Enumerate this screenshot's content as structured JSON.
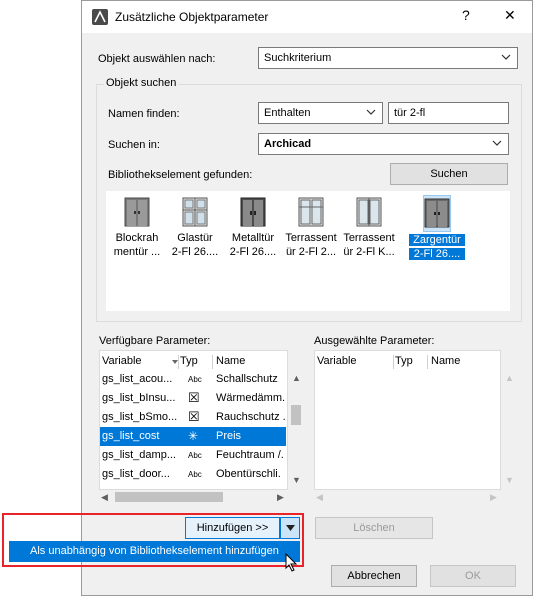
{
  "window": {
    "title": "Zusätzliche Objektparameter",
    "help_label": "?",
    "close_label": "✕"
  },
  "select_by": {
    "label": "Objekt auswählen nach:",
    "value": "Suchkriterium"
  },
  "search_group": {
    "title": "Objekt suchen",
    "find_names_label": "Namen finden:",
    "match_mode": "Enthalten",
    "search_text": "tür 2-fl",
    "search_in_label": "Suchen in:",
    "search_in_value": "Archicad",
    "found_label": "Bibliothekselement gefunden:",
    "search_button": "Suchen"
  },
  "library_items": [
    {
      "line1": "Blockrah",
      "line2": "mentür ..."
    },
    {
      "line1": "Glastür",
      "line2": "2-Fl 26...."
    },
    {
      "line1": "Metalltür",
      "line2": "2-Fl 26...."
    },
    {
      "line1": "Terrassent",
      "line2": "ür 2-Fl 2..."
    },
    {
      "line1": "Terrassent",
      "line2": "ür 2-Fl K..."
    },
    {
      "line1": "Zargentür",
      "line2": "2-Fl 26....",
      "selected": true
    }
  ],
  "available": {
    "title": "Verfügbare Parameter:",
    "headers": {
      "variable": "Variable",
      "type": "Typ",
      "name": "Name"
    },
    "rows": [
      {
        "variable": "gs_list_acou...",
        "type": "Abc",
        "name": "Schallschutz"
      },
      {
        "variable": "gs_list_bInsu...",
        "type": "☒",
        "name": "Wärmedämm."
      },
      {
        "variable": "gs_list_bSmo...",
        "type": "☒",
        "name": "Rauchschutz ."
      },
      {
        "variable": "gs_list_cost",
        "type": "✳",
        "name": "Preis",
        "selected": true
      },
      {
        "variable": "gs_list_damp...",
        "type": "Abc",
        "name": "Feuchtraum /."
      },
      {
        "variable": "gs_list_door...",
        "type": "Abc",
        "name": "Obentürschli."
      }
    ]
  },
  "selected_params": {
    "title": "Ausgewählte Parameter:",
    "headers": {
      "variable": "Variable",
      "type": "Typ",
      "name": "Name"
    }
  },
  "buttons": {
    "add": "Hinzufügen >>",
    "delete": "Löschen",
    "cancel": "Abbrechen",
    "ok": "OK"
  },
  "dropdown_menu": {
    "item": "Als unabhängig von Bibliothekselement hinzufügen"
  },
  "colors": {
    "accent": "#0078d7",
    "highlight_border": "#e8232a"
  }
}
